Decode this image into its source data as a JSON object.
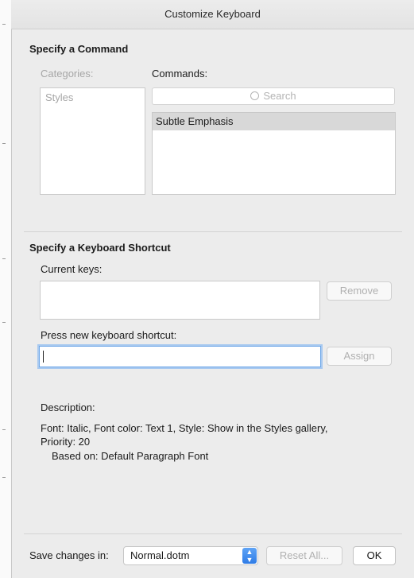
{
  "window": {
    "title": "Customize Keyboard"
  },
  "command_section": {
    "heading": "Specify a Command",
    "categories_label": "Categories:",
    "categories": [
      "Styles"
    ],
    "commands_label": "Commands:",
    "search_placeholder": "Search",
    "commands": [
      "Subtle Emphasis"
    ]
  },
  "shortcut_section": {
    "heading": "Specify a Keyboard Shortcut",
    "current_keys_label": "Current keys:",
    "remove_label": "Remove",
    "press_new_label": "Press new keyboard shortcut:",
    "new_shortcut_value": "",
    "assign_label": "Assign"
  },
  "description": {
    "label": "Description:",
    "line1": "Font: Italic, Font color: Text 1, Style: Show in the Styles gallery,",
    "line2": "Priority: 20",
    "line3": "Based on: Default Paragraph Font"
  },
  "footer": {
    "save_label": "Save changes in:",
    "template": "Normal.dotm",
    "reset_label": "Reset All...",
    "ok_label": "OK"
  },
  "icons": {
    "stepper": "up-down-chevron-icon"
  }
}
